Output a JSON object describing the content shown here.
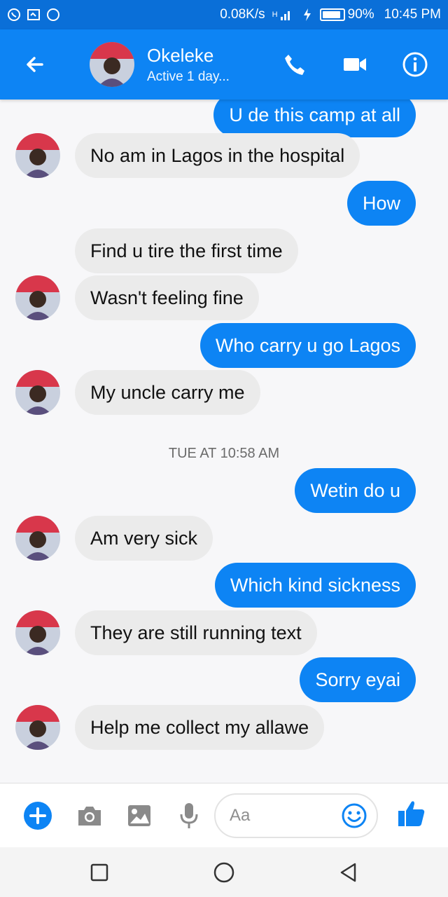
{
  "status_bar": {
    "speed": "0.08K/s",
    "network": "H",
    "battery_percent": "90%",
    "battery_level": 0.9,
    "time": "10:45 PM"
  },
  "header": {
    "contact_name": "Okeleke",
    "contact_status": "Active 1 day..."
  },
  "conversation": {
    "messages": [
      {
        "sender": "me",
        "text": "U de this camp at all"
      },
      {
        "sender": "contact",
        "text": "No am in Lagos in the hospital"
      },
      {
        "sender": "me",
        "text": "How"
      },
      {
        "sender": "contact",
        "text": "Find u tire the first time"
      },
      {
        "sender": "contact",
        "text": "Wasn't feeling fine"
      },
      {
        "sender": "me",
        "text": "Who carry u go Lagos"
      },
      {
        "sender": "contact",
        "text": "My uncle carry me"
      },
      {
        "sender": "me",
        "text": "Wetin do u"
      },
      {
        "sender": "contact",
        "text": "Am very sick"
      },
      {
        "sender": "me",
        "text": "Which kind sickness"
      },
      {
        "sender": "contact",
        "text": "They are still running text"
      },
      {
        "sender": "me",
        "text": "Sorry eyai"
      },
      {
        "sender": "contact",
        "text": "Help me collect my allawe"
      }
    ],
    "timestamp_divider": "TUE AT 10:58 AM"
  },
  "composer": {
    "placeholder": "Aa"
  },
  "icons": {
    "status": [
      "whatsapp-icon",
      "screenshot-icon",
      "chat-icon",
      "signal-icon",
      "charging-icon",
      "battery-icon"
    ],
    "header": [
      "back-arrow-icon",
      "phone-icon",
      "video-icon",
      "info-icon"
    ],
    "composer": [
      "plus-icon",
      "camera-icon",
      "image-icon",
      "microphone-icon",
      "emoji-icon",
      "thumbs-up-icon"
    ],
    "nav": [
      "recent-apps-icon",
      "home-icon",
      "back-icon"
    ]
  },
  "colors": {
    "status_bar": "#0a6fd8",
    "header": "#0d84f4",
    "outgoing_bubble": "#0d84f4",
    "incoming_bubble": "#ebebeb",
    "chat_background": "#f7f7f9"
  }
}
